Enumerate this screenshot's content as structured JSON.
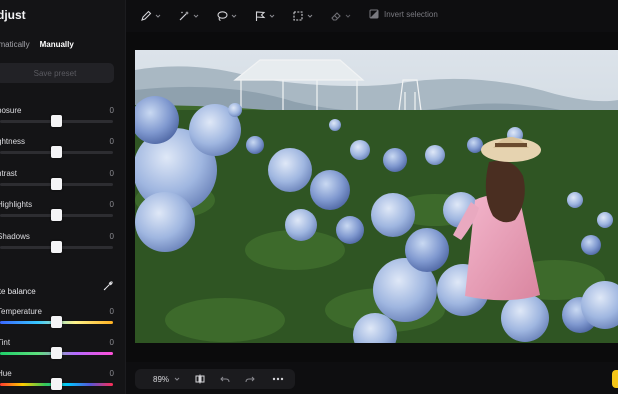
{
  "panel": {
    "title": "djust",
    "modes": [
      "omatically",
      "Manually"
    ],
    "active_mode": "Manually",
    "save_preset_label": "Save preset",
    "sliders": [
      {
        "label": "posure",
        "value": "0",
        "level": 0.5
      },
      {
        "label": "ghtness",
        "value": "0",
        "level": 0.5
      },
      {
        "label": "ntrast",
        "value": "0",
        "level": 0.5
      },
      {
        "label": "Highlights",
        "value": "0",
        "level": 0.5
      },
      {
        "label": "Shadows",
        "value": "0",
        "level": 0.5
      }
    ],
    "white_balance_label": "ite balance",
    "color_sliders": [
      {
        "label": "Temperature",
        "value": "0",
        "level": 0.5
      },
      {
        "label": "Tint",
        "value": "0",
        "level": 0.5
      },
      {
        "label": "Hue",
        "value": "0",
        "level": 0.5
      }
    ]
  },
  "toolbar": {
    "tools": [
      "brush-icon",
      "magic-wand-icon",
      "lasso-icon",
      "flag-lasso-icon",
      "marquee-icon",
      "eraser-icon"
    ],
    "invert_label": "Invert selection"
  },
  "bottombar": {
    "zoom": "89%"
  },
  "colors": {
    "accent_yellow": "#f5c518",
    "panel_bg": "#141416"
  }
}
